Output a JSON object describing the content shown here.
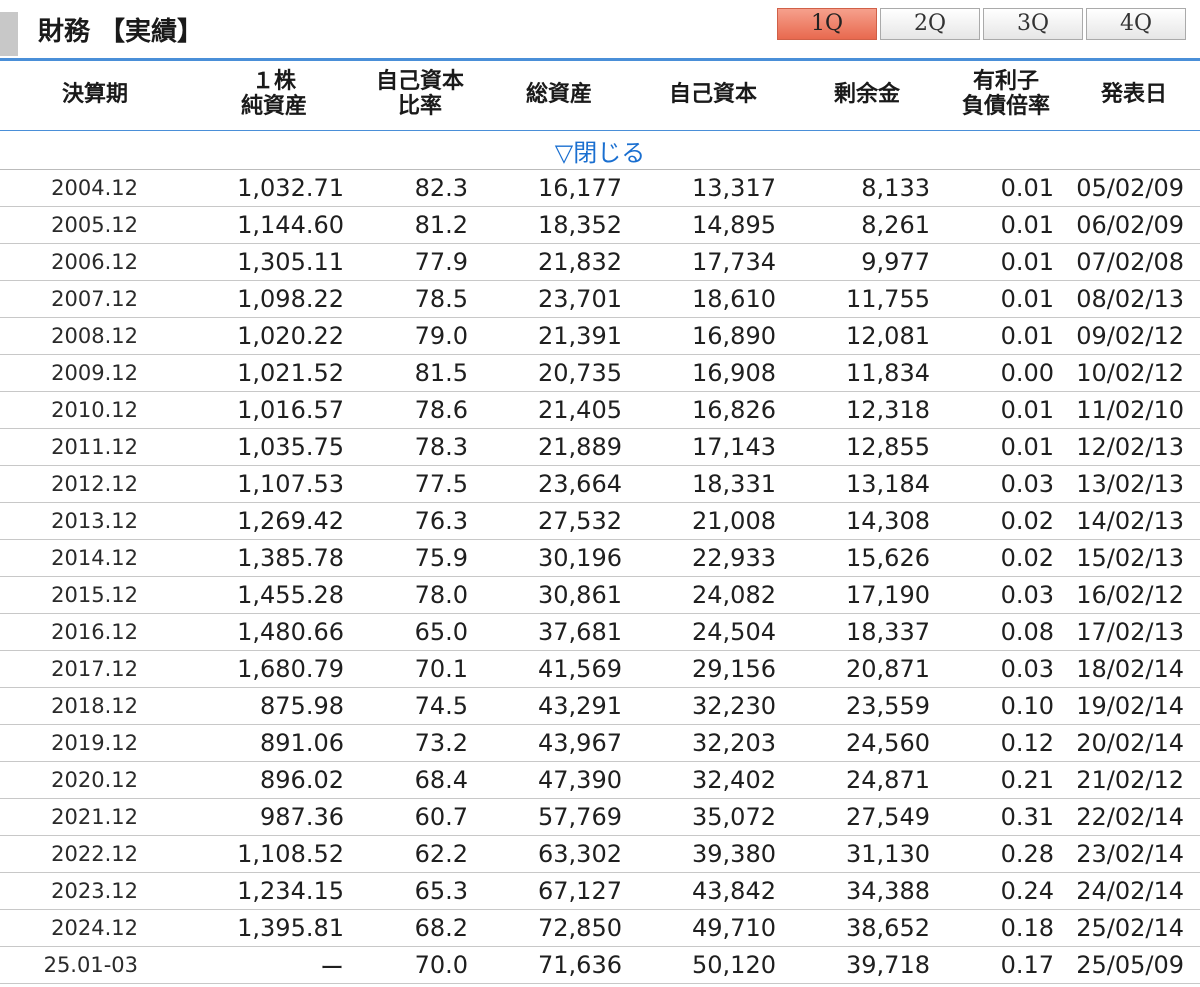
{
  "header": {
    "title": "財務 【実績】",
    "quarter_tabs": [
      "1Q",
      "2Q",
      "3Q",
      "4Q"
    ],
    "active_tab": "1Q"
  },
  "table": {
    "columns": [
      {
        "line1": "決算期",
        "line2": ""
      },
      {
        "line1": "１株",
        "line2": "純資産"
      },
      {
        "line1": "自己資本",
        "line2": "比率"
      },
      {
        "line1": "総資産",
        "line2": ""
      },
      {
        "line1": "自己資本",
        "line2": ""
      },
      {
        "line1": "剰余金",
        "line2": ""
      },
      {
        "line1": "有利子",
        "line2": "負債倍率"
      },
      {
        "line1": "発表日",
        "line2": ""
      }
    ],
    "toggle_label": "▽閉じる",
    "rows": [
      [
        "2004.12",
        "1,032.71",
        "82.3",
        "16,177",
        "13,317",
        "8,133",
        "0.01",
        "05/02/09"
      ],
      [
        "2005.12",
        "1,144.60",
        "81.2",
        "18,352",
        "14,895",
        "8,261",
        "0.01",
        "06/02/09"
      ],
      [
        "2006.12",
        "1,305.11",
        "77.9",
        "21,832",
        "17,734",
        "9,977",
        "0.01",
        "07/02/08"
      ],
      [
        "2007.12",
        "1,098.22",
        "78.5",
        "23,701",
        "18,610",
        "11,755",
        "0.01",
        "08/02/13"
      ],
      [
        "2008.12",
        "1,020.22",
        "79.0",
        "21,391",
        "16,890",
        "12,081",
        "0.01",
        "09/02/12"
      ],
      [
        "2009.12",
        "1,021.52",
        "81.5",
        "20,735",
        "16,908",
        "11,834",
        "0.00",
        "10/02/12"
      ],
      [
        "2010.12",
        "1,016.57",
        "78.6",
        "21,405",
        "16,826",
        "12,318",
        "0.01",
        "11/02/10"
      ],
      [
        "2011.12",
        "1,035.75",
        "78.3",
        "21,889",
        "17,143",
        "12,855",
        "0.01",
        "12/02/13"
      ],
      [
        "2012.12",
        "1,107.53",
        "77.5",
        "23,664",
        "18,331",
        "13,184",
        "0.03",
        "13/02/13"
      ],
      [
        "2013.12",
        "1,269.42",
        "76.3",
        "27,532",
        "21,008",
        "14,308",
        "0.02",
        "14/02/13"
      ],
      [
        "2014.12",
        "1,385.78",
        "75.9",
        "30,196",
        "22,933",
        "15,626",
        "0.02",
        "15/02/13"
      ],
      [
        "2015.12",
        "1,455.28",
        "78.0",
        "30,861",
        "24,082",
        "17,190",
        "0.03",
        "16/02/12"
      ],
      [
        "2016.12",
        "1,480.66",
        "65.0",
        "37,681",
        "24,504",
        "18,337",
        "0.08",
        "17/02/13"
      ],
      [
        "2017.12",
        "1,680.79",
        "70.1",
        "41,569",
        "29,156",
        "20,871",
        "0.03",
        "18/02/14"
      ],
      [
        "2018.12",
        "875.98",
        "74.5",
        "43,291",
        "32,230",
        "23,559",
        "0.10",
        "19/02/14"
      ],
      [
        "2019.12",
        "891.06",
        "73.2",
        "43,967",
        "32,203",
        "24,560",
        "0.12",
        "20/02/14"
      ],
      [
        "2020.12",
        "896.02",
        "68.4",
        "47,390",
        "32,402",
        "24,871",
        "0.21",
        "21/02/12"
      ],
      [
        "2021.12",
        "987.36",
        "60.7",
        "57,769",
        "35,072",
        "27,549",
        "0.31",
        "22/02/14"
      ],
      [
        "2022.12",
        "1,108.52",
        "62.2",
        "63,302",
        "39,380",
        "31,130",
        "0.28",
        "23/02/14"
      ],
      [
        "2023.12",
        "1,234.15",
        "65.3",
        "67,127",
        "43,842",
        "34,388",
        "0.24",
        "24/02/14"
      ],
      [
        "2024.12",
        "1,395.81",
        "68.2",
        "72,850",
        "49,710",
        "38,652",
        "0.18",
        "25/02/14"
      ],
      [
        "25.01-03",
        "ー",
        "70.0",
        "71,636",
        "50,120",
        "39,718",
        "0.17",
        "25/05/09"
      ]
    ]
  }
}
